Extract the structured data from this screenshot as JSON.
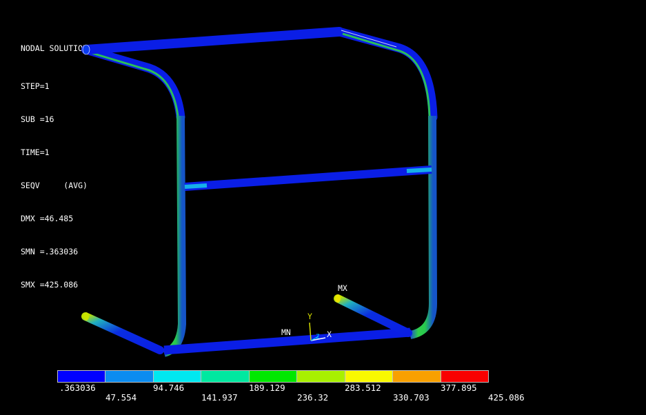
{
  "solution_info": {
    "title": "NODAL SOLUTION",
    "step": "STEP=1",
    "sub": "SUB =16",
    "time": "TIME=1",
    "result": "SEQV     (AVG)",
    "dmx": "DMX =46.485",
    "smn": "SMN =.363036",
    "smx": "SMX =425.086"
  },
  "markers": {
    "max": "MX",
    "min": "MN"
  },
  "triad": {
    "y": "Y",
    "z": "Z",
    "x": "X"
  },
  "legend": {
    "colors": [
      "#0000ff",
      "#0b8cf0",
      "#00e8f0",
      "#00e8a0",
      "#00e800",
      "#a8f000",
      "#f8f800",
      "#f8a000",
      "#f80000"
    ],
    "upper_ticks": [
      ".363036",
      "94.746",
      "189.129",
      "283.512",
      "377.895"
    ],
    "lower_ticks": [
      "47.554",
      "141.937",
      "236.32",
      "330.703",
      "425.086"
    ]
  },
  "colors": {
    "background": "#000000",
    "tube_low": "#0a1ee6",
    "tube_mid": "#2fd04a",
    "tube_edge": "#0d8fe8"
  }
}
